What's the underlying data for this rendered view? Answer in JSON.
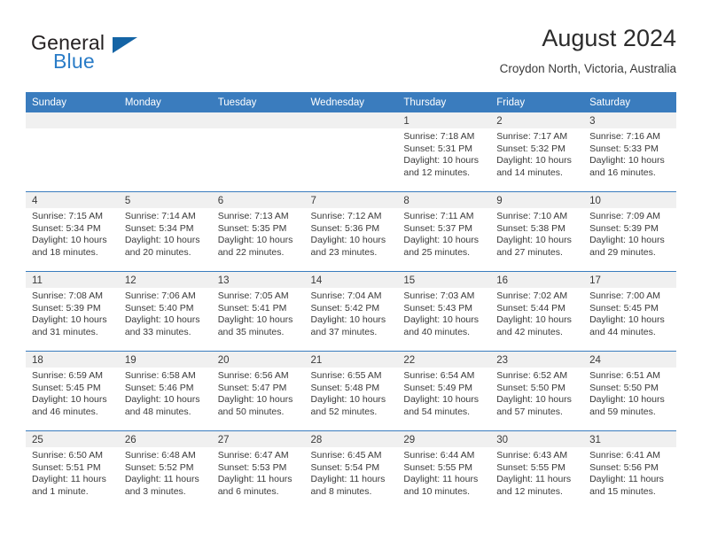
{
  "brand": {
    "name_top": "General",
    "name_bottom": "Blue",
    "accent_color": "#2a7cc7",
    "triangle_color": "#1464a5"
  },
  "header": {
    "title": "August 2024",
    "subtitle": "Croydon North, Victoria, Australia"
  },
  "theme": {
    "header_row_bg": "#3a7cbe",
    "day_band_bg": "#f0f0f0",
    "text_color": "#3a3a3a"
  },
  "weekdays": [
    "Sunday",
    "Monday",
    "Tuesday",
    "Wednesday",
    "Thursday",
    "Friday",
    "Saturday"
  ],
  "weeks": [
    [
      {
        "day": "",
        "sunrise": "",
        "sunset": "",
        "daylight_line1": "",
        "daylight_line2": ""
      },
      {
        "day": "",
        "sunrise": "",
        "sunset": "",
        "daylight_line1": "",
        "daylight_line2": ""
      },
      {
        "day": "",
        "sunrise": "",
        "sunset": "",
        "daylight_line1": "",
        "daylight_line2": ""
      },
      {
        "day": "",
        "sunrise": "",
        "sunset": "",
        "daylight_line1": "",
        "daylight_line2": ""
      },
      {
        "day": "1",
        "sunrise": "Sunrise: 7:18 AM",
        "sunset": "Sunset: 5:31 PM",
        "daylight_line1": "Daylight: 10 hours",
        "daylight_line2": "and 12 minutes."
      },
      {
        "day": "2",
        "sunrise": "Sunrise: 7:17 AM",
        "sunset": "Sunset: 5:32 PM",
        "daylight_line1": "Daylight: 10 hours",
        "daylight_line2": "and 14 minutes."
      },
      {
        "day": "3",
        "sunrise": "Sunrise: 7:16 AM",
        "sunset": "Sunset: 5:33 PM",
        "daylight_line1": "Daylight: 10 hours",
        "daylight_line2": "and 16 minutes."
      }
    ],
    [
      {
        "day": "4",
        "sunrise": "Sunrise: 7:15 AM",
        "sunset": "Sunset: 5:34 PM",
        "daylight_line1": "Daylight: 10 hours",
        "daylight_line2": "and 18 minutes."
      },
      {
        "day": "5",
        "sunrise": "Sunrise: 7:14 AM",
        "sunset": "Sunset: 5:34 PM",
        "daylight_line1": "Daylight: 10 hours",
        "daylight_line2": "and 20 minutes."
      },
      {
        "day": "6",
        "sunrise": "Sunrise: 7:13 AM",
        "sunset": "Sunset: 5:35 PM",
        "daylight_line1": "Daylight: 10 hours",
        "daylight_line2": "and 22 minutes."
      },
      {
        "day": "7",
        "sunrise": "Sunrise: 7:12 AM",
        "sunset": "Sunset: 5:36 PM",
        "daylight_line1": "Daylight: 10 hours",
        "daylight_line2": "and 23 minutes."
      },
      {
        "day": "8",
        "sunrise": "Sunrise: 7:11 AM",
        "sunset": "Sunset: 5:37 PM",
        "daylight_line1": "Daylight: 10 hours",
        "daylight_line2": "and 25 minutes."
      },
      {
        "day": "9",
        "sunrise": "Sunrise: 7:10 AM",
        "sunset": "Sunset: 5:38 PM",
        "daylight_line1": "Daylight: 10 hours",
        "daylight_line2": "and 27 minutes."
      },
      {
        "day": "10",
        "sunrise": "Sunrise: 7:09 AM",
        "sunset": "Sunset: 5:39 PM",
        "daylight_line1": "Daylight: 10 hours",
        "daylight_line2": "and 29 minutes."
      }
    ],
    [
      {
        "day": "11",
        "sunrise": "Sunrise: 7:08 AM",
        "sunset": "Sunset: 5:39 PM",
        "daylight_line1": "Daylight: 10 hours",
        "daylight_line2": "and 31 minutes."
      },
      {
        "day": "12",
        "sunrise": "Sunrise: 7:06 AM",
        "sunset": "Sunset: 5:40 PM",
        "daylight_line1": "Daylight: 10 hours",
        "daylight_line2": "and 33 minutes."
      },
      {
        "day": "13",
        "sunrise": "Sunrise: 7:05 AM",
        "sunset": "Sunset: 5:41 PM",
        "daylight_line1": "Daylight: 10 hours",
        "daylight_line2": "and 35 minutes."
      },
      {
        "day": "14",
        "sunrise": "Sunrise: 7:04 AM",
        "sunset": "Sunset: 5:42 PM",
        "daylight_line1": "Daylight: 10 hours",
        "daylight_line2": "and 37 minutes."
      },
      {
        "day": "15",
        "sunrise": "Sunrise: 7:03 AM",
        "sunset": "Sunset: 5:43 PM",
        "daylight_line1": "Daylight: 10 hours",
        "daylight_line2": "and 40 minutes."
      },
      {
        "day": "16",
        "sunrise": "Sunrise: 7:02 AM",
        "sunset": "Sunset: 5:44 PM",
        "daylight_line1": "Daylight: 10 hours",
        "daylight_line2": "and 42 minutes."
      },
      {
        "day": "17",
        "sunrise": "Sunrise: 7:00 AM",
        "sunset": "Sunset: 5:45 PM",
        "daylight_line1": "Daylight: 10 hours",
        "daylight_line2": "and 44 minutes."
      }
    ],
    [
      {
        "day": "18",
        "sunrise": "Sunrise: 6:59 AM",
        "sunset": "Sunset: 5:45 PM",
        "daylight_line1": "Daylight: 10 hours",
        "daylight_line2": "and 46 minutes."
      },
      {
        "day": "19",
        "sunrise": "Sunrise: 6:58 AM",
        "sunset": "Sunset: 5:46 PM",
        "daylight_line1": "Daylight: 10 hours",
        "daylight_line2": "and 48 minutes."
      },
      {
        "day": "20",
        "sunrise": "Sunrise: 6:56 AM",
        "sunset": "Sunset: 5:47 PM",
        "daylight_line1": "Daylight: 10 hours",
        "daylight_line2": "and 50 minutes."
      },
      {
        "day": "21",
        "sunrise": "Sunrise: 6:55 AM",
        "sunset": "Sunset: 5:48 PM",
        "daylight_line1": "Daylight: 10 hours",
        "daylight_line2": "and 52 minutes."
      },
      {
        "day": "22",
        "sunrise": "Sunrise: 6:54 AM",
        "sunset": "Sunset: 5:49 PM",
        "daylight_line1": "Daylight: 10 hours",
        "daylight_line2": "and 54 minutes."
      },
      {
        "day": "23",
        "sunrise": "Sunrise: 6:52 AM",
        "sunset": "Sunset: 5:50 PM",
        "daylight_line1": "Daylight: 10 hours",
        "daylight_line2": "and 57 minutes."
      },
      {
        "day": "24",
        "sunrise": "Sunrise: 6:51 AM",
        "sunset": "Sunset: 5:50 PM",
        "daylight_line1": "Daylight: 10 hours",
        "daylight_line2": "and 59 minutes."
      }
    ],
    [
      {
        "day": "25",
        "sunrise": "Sunrise: 6:50 AM",
        "sunset": "Sunset: 5:51 PM",
        "daylight_line1": "Daylight: 11 hours",
        "daylight_line2": "and 1 minute."
      },
      {
        "day": "26",
        "sunrise": "Sunrise: 6:48 AM",
        "sunset": "Sunset: 5:52 PM",
        "daylight_line1": "Daylight: 11 hours",
        "daylight_line2": "and 3 minutes."
      },
      {
        "day": "27",
        "sunrise": "Sunrise: 6:47 AM",
        "sunset": "Sunset: 5:53 PM",
        "daylight_line1": "Daylight: 11 hours",
        "daylight_line2": "and 6 minutes."
      },
      {
        "day": "28",
        "sunrise": "Sunrise: 6:45 AM",
        "sunset": "Sunset: 5:54 PM",
        "daylight_line1": "Daylight: 11 hours",
        "daylight_line2": "and 8 minutes."
      },
      {
        "day": "29",
        "sunrise": "Sunrise: 6:44 AM",
        "sunset": "Sunset: 5:55 PM",
        "daylight_line1": "Daylight: 11 hours",
        "daylight_line2": "and 10 minutes."
      },
      {
        "day": "30",
        "sunrise": "Sunrise: 6:43 AM",
        "sunset": "Sunset: 5:55 PM",
        "daylight_line1": "Daylight: 11 hours",
        "daylight_line2": "and 12 minutes."
      },
      {
        "day": "31",
        "sunrise": "Sunrise: 6:41 AM",
        "sunset": "Sunset: 5:56 PM",
        "daylight_line1": "Daylight: 11 hours",
        "daylight_line2": "and 15 minutes."
      }
    ]
  ]
}
